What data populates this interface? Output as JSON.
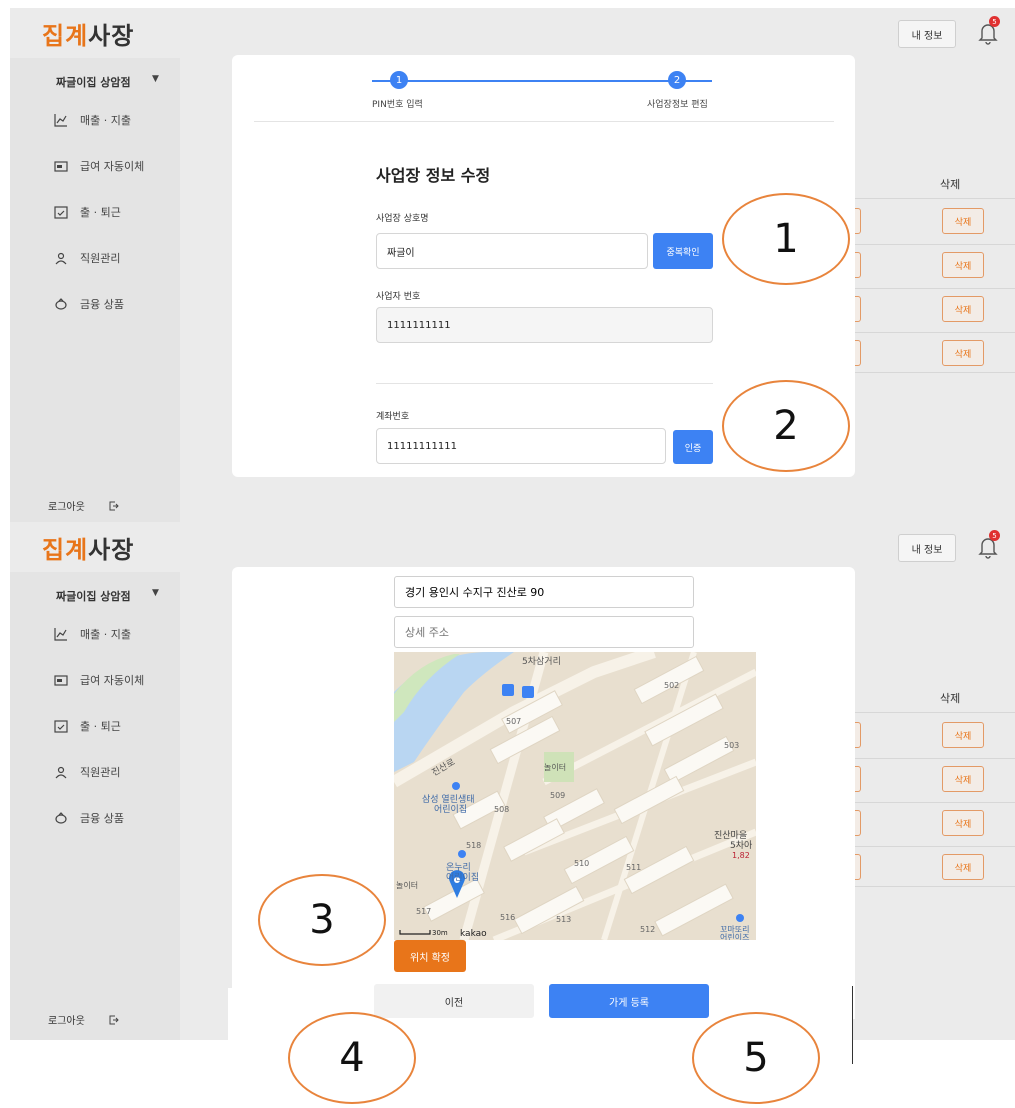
{
  "app": {
    "logo_part1": "집계",
    "logo_part2": "사장",
    "my_info": "내 정보",
    "notification_count": "5",
    "store_name": "짜글이집 상암점",
    "store_caret": "▼",
    "logout": "로그아웃"
  },
  "sidebar": {
    "items": [
      {
        "label": "매출 · 지출",
        "icon": "chart-line-icon"
      },
      {
        "label": "급여 자동이체",
        "icon": "wallet-icon"
      },
      {
        "label": "출 · 퇴근",
        "icon": "calendar-check-icon"
      },
      {
        "label": "직원관리",
        "icon": "person-icon"
      },
      {
        "label": "금융 상품",
        "icon": "piggy-bank-icon"
      }
    ]
  },
  "table": {
    "delete_header": "삭제",
    "delete_label": "삭제"
  },
  "stepper": {
    "step1_num": "1",
    "step1_label": "PIN번호 입력",
    "step2_num": "2",
    "step2_label": "사업장정보 편집"
  },
  "form": {
    "title": "사업장 정보 수정",
    "business_name_label": "사업장 상호명",
    "business_name_value": "짜글이",
    "dup_check": "중복확인",
    "business_number_label": "사업자 번호",
    "business_number_value": "1111111111",
    "account_label": "계좌번호",
    "account_value": "11111111111",
    "verify": "인증"
  },
  "address": {
    "address_value": "경기 용인시 수지구 진산로 90",
    "detail_placeholder": "상세 주소",
    "confirm_location": "위치 확정",
    "prev": "이전",
    "register": "가게 등록"
  },
  "map": {
    "labels": {
      "intersection": "5차삼거리",
      "road": "진산로",
      "playground1": "놀이터",
      "daycare1_line1": "삼성 열린생태",
      "daycare1_line2": "어린이집",
      "daycare2_line1": "온누리",
      "daycare2_line2": "어린이집",
      "playground2": "놀이터",
      "village_line1": "진산마을",
      "village_line2": "5차아",
      "village_line3": "1,82",
      "daycare3_line1": "꼬마또리",
      "daycare3_line2": "어린이즈",
      "b507": "507",
      "b508": "508",
      "b509": "509",
      "b510": "510",
      "b511": "511",
      "b512": "512",
      "b513": "513",
      "b516": "516",
      "b517": "517",
      "b518": "518",
      "b502": "502",
      "b503": "503",
      "scale": "30m",
      "brand": "kakao"
    }
  },
  "annotations": {
    "a1": "1",
    "a2": "2",
    "a3": "3",
    "a4": "4",
    "a5": "5"
  },
  "colors": {
    "accent_orange": "#e8751a",
    "accent_blue": "#3d82f3"
  }
}
